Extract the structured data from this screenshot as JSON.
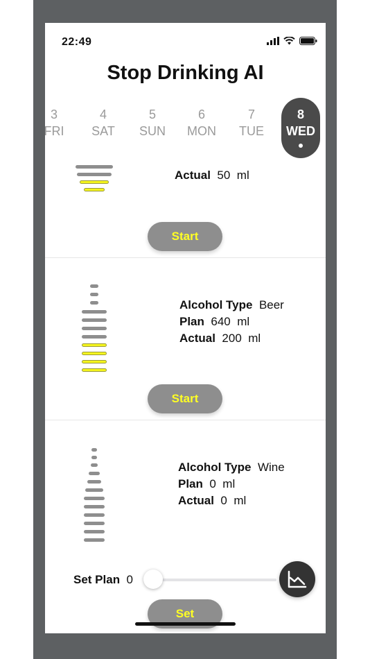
{
  "status": {
    "time": "22:49"
  },
  "app": {
    "title": "Stop Drinking AI"
  },
  "days": [
    {
      "num": "3",
      "wd": "FRI"
    },
    {
      "num": "4",
      "wd": "SAT"
    },
    {
      "num": "5",
      "wd": "SUN"
    },
    {
      "num": "6",
      "wd": "MON"
    },
    {
      "num": "7",
      "wd": "TUE"
    },
    {
      "num": "8",
      "wd": "WED"
    }
  ],
  "labels": {
    "alcohol_type": "Alcohol Type",
    "plan": "Plan",
    "actual": "Actual",
    "ml": "ml",
    "set_plan": "Set Plan"
  },
  "entries": [
    {
      "actual": "50",
      "button": "Start"
    },
    {
      "alcohol_type": "Beer",
      "plan": "640",
      "actual": "200",
      "button": "Start"
    },
    {
      "alcohol_type": "Wine",
      "plan": "0",
      "actual": "0",
      "button": "Set"
    }
  ],
  "set_plan": {
    "value": "0",
    "slider_fraction": 0
  },
  "colors": {
    "accent": "#ffff24",
    "button": "#8e8e8e",
    "selected_day": "#4a4a4a",
    "fill": "#f4f41e"
  }
}
